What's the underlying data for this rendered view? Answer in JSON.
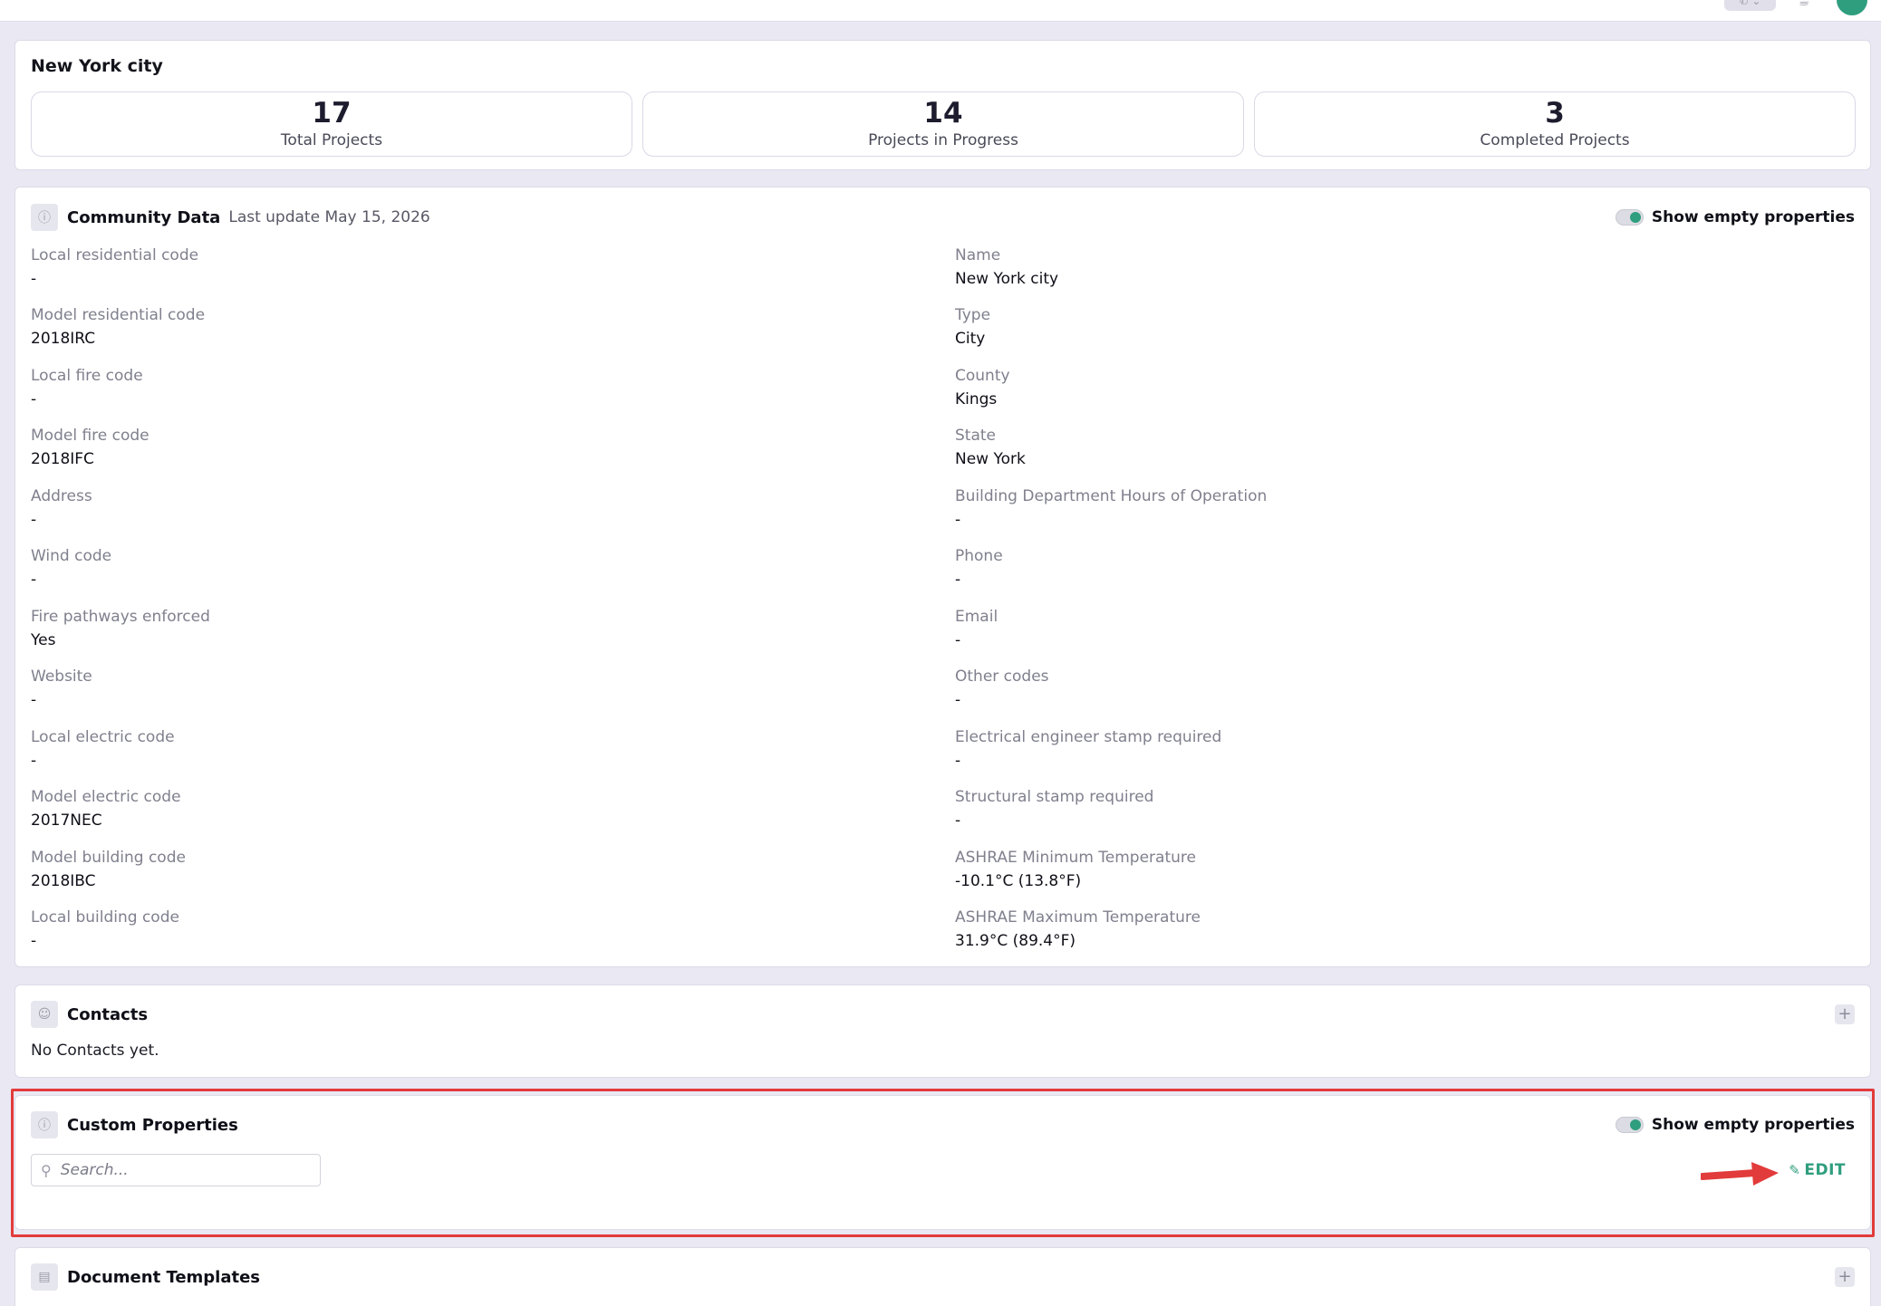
{
  "summary": {
    "title": "New York city",
    "stats": [
      {
        "value": "17",
        "label": "Total Projects"
      },
      {
        "value": "14",
        "label": "Projects in Progress"
      },
      {
        "value": "3",
        "label": "Completed Projects"
      }
    ]
  },
  "community": {
    "title": "Community Data",
    "last_update": "Last update May 15, 2026",
    "toggle_label": "Show empty properties",
    "left": [
      {
        "label": "Local residential code",
        "value": "-"
      },
      {
        "label": "Model residential code",
        "value": "2018IRC"
      },
      {
        "label": "Local fire code",
        "value": "-"
      },
      {
        "label": "Model fire code",
        "value": "2018IFC"
      },
      {
        "label": "Address",
        "value": "-"
      },
      {
        "label": "Wind code",
        "value": "-"
      },
      {
        "label": "Fire pathways enforced",
        "value": "Yes"
      },
      {
        "label": "Website",
        "value": "-"
      },
      {
        "label": "Local electric code",
        "value": "-"
      },
      {
        "label": "Model electric code",
        "value": "2017NEC"
      },
      {
        "label": "Model building code",
        "value": "2018IBC"
      },
      {
        "label": "Local building code",
        "value": "-"
      }
    ],
    "right": [
      {
        "label": "Name",
        "value": "New York city"
      },
      {
        "label": "Type",
        "value": "City"
      },
      {
        "label": "County",
        "value": "Kings"
      },
      {
        "label": "State",
        "value": "New York"
      },
      {
        "label": "Building Department Hours of Operation",
        "value": "-"
      },
      {
        "label": "Phone",
        "value": "-"
      },
      {
        "label": "Email",
        "value": "-"
      },
      {
        "label": "Other codes",
        "value": "-"
      },
      {
        "label": "Electrical engineer stamp required",
        "value": "-"
      },
      {
        "label": "Structural stamp required",
        "value": "-"
      },
      {
        "label": "ASHRAE Minimum Temperature",
        "value": "-10.1°C (13.8°F)"
      },
      {
        "label": "ASHRAE Maximum Temperature",
        "value": "31.9°C (89.4°F)"
      }
    ]
  },
  "contacts": {
    "title": "Contacts",
    "empty_message": "No Contacts yet.",
    "add_label": "+"
  },
  "custom_properties": {
    "title": "Custom Properties",
    "toggle_label": "Show empty properties",
    "search_placeholder": "Search...",
    "edit_label": "EDIT"
  },
  "document_templates": {
    "title": "Document Templates",
    "add_label": "+"
  },
  "icons": {
    "info": "info-icon",
    "users": "users-icon",
    "document": "document-icon",
    "search": "search-icon",
    "pencil": "pencil-icon",
    "phone": "phone-icon",
    "gift": "gift-icon"
  },
  "colors": {
    "accent": "#2f9e7e",
    "highlight": "#e23b3b",
    "background": "#e9e8f3"
  }
}
